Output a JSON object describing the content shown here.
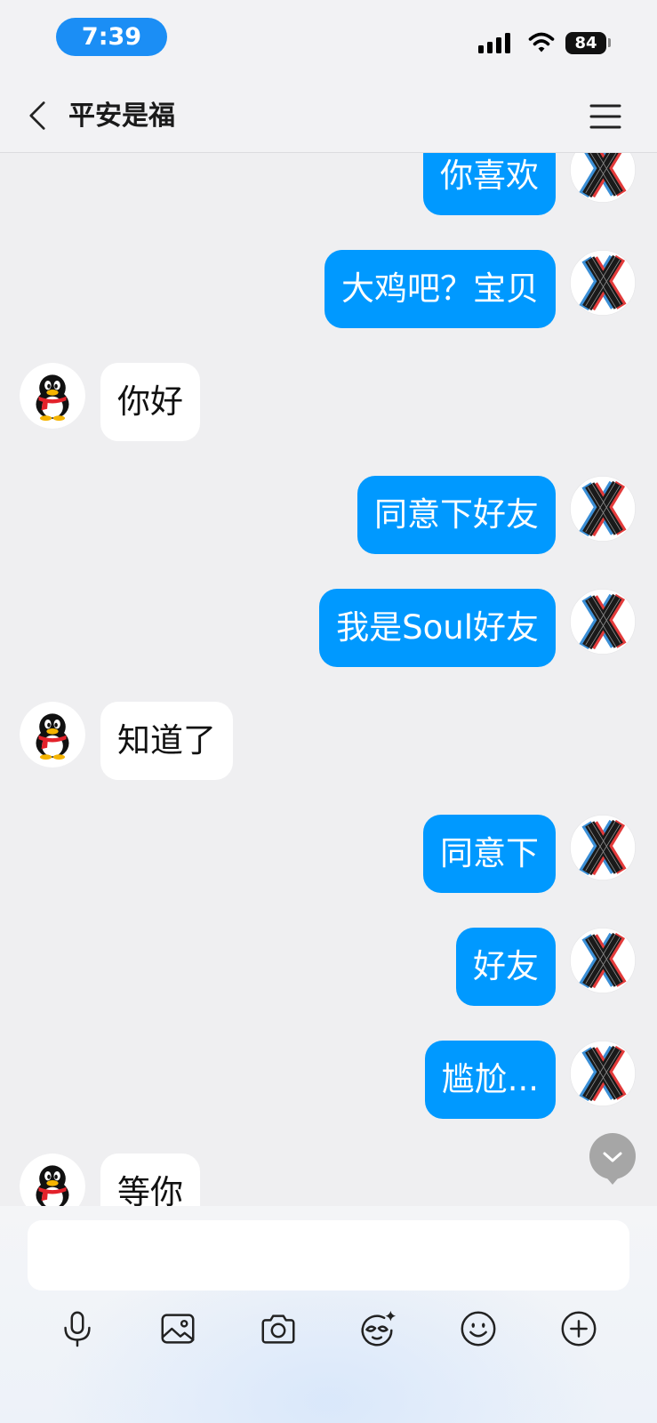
{
  "status_bar": {
    "time": "7:39",
    "battery": "84",
    "icons": [
      "signal-icon",
      "wifi-icon",
      "battery-icon"
    ]
  },
  "header": {
    "title": "平安是福",
    "icons": {
      "back": "chevron-left-icon",
      "menu": "hamburger-menu-icon"
    }
  },
  "avatars": {
    "self": "x-logo-avatar",
    "peer": "qq-penguin-avatar"
  },
  "messages": [
    {
      "outgoing": true,
      "text": "你喜欢"
    },
    {
      "outgoing": true,
      "text": "大鸡吧？宝贝"
    },
    {
      "outgoing": false,
      "text": "你好"
    },
    {
      "outgoing": true,
      "text": "同意下好友"
    },
    {
      "outgoing": true,
      "text": "我是Soul好友"
    },
    {
      "outgoing": false,
      "text": "知道了"
    },
    {
      "outgoing": true,
      "text": "同意下"
    },
    {
      "outgoing": true,
      "text": "好友"
    },
    {
      "outgoing": true,
      "text": "尴尬..."
    },
    {
      "outgoing": false,
      "text": "等你"
    }
  ],
  "scroll_down": {
    "icon": "chevron-down-icon"
  },
  "composer": {
    "value": "",
    "toolbar_icons": [
      "microphone-icon",
      "image-icon",
      "camera-icon",
      "face-sparkle-icon",
      "emoji-icon",
      "plus-circle-icon"
    ]
  },
  "colors": {
    "outgoing_bubble": "#0099ff",
    "incoming_bubble": "#ffffff",
    "time_pill": "#1b8ef5",
    "scroll_button": "#a6a6a6"
  }
}
